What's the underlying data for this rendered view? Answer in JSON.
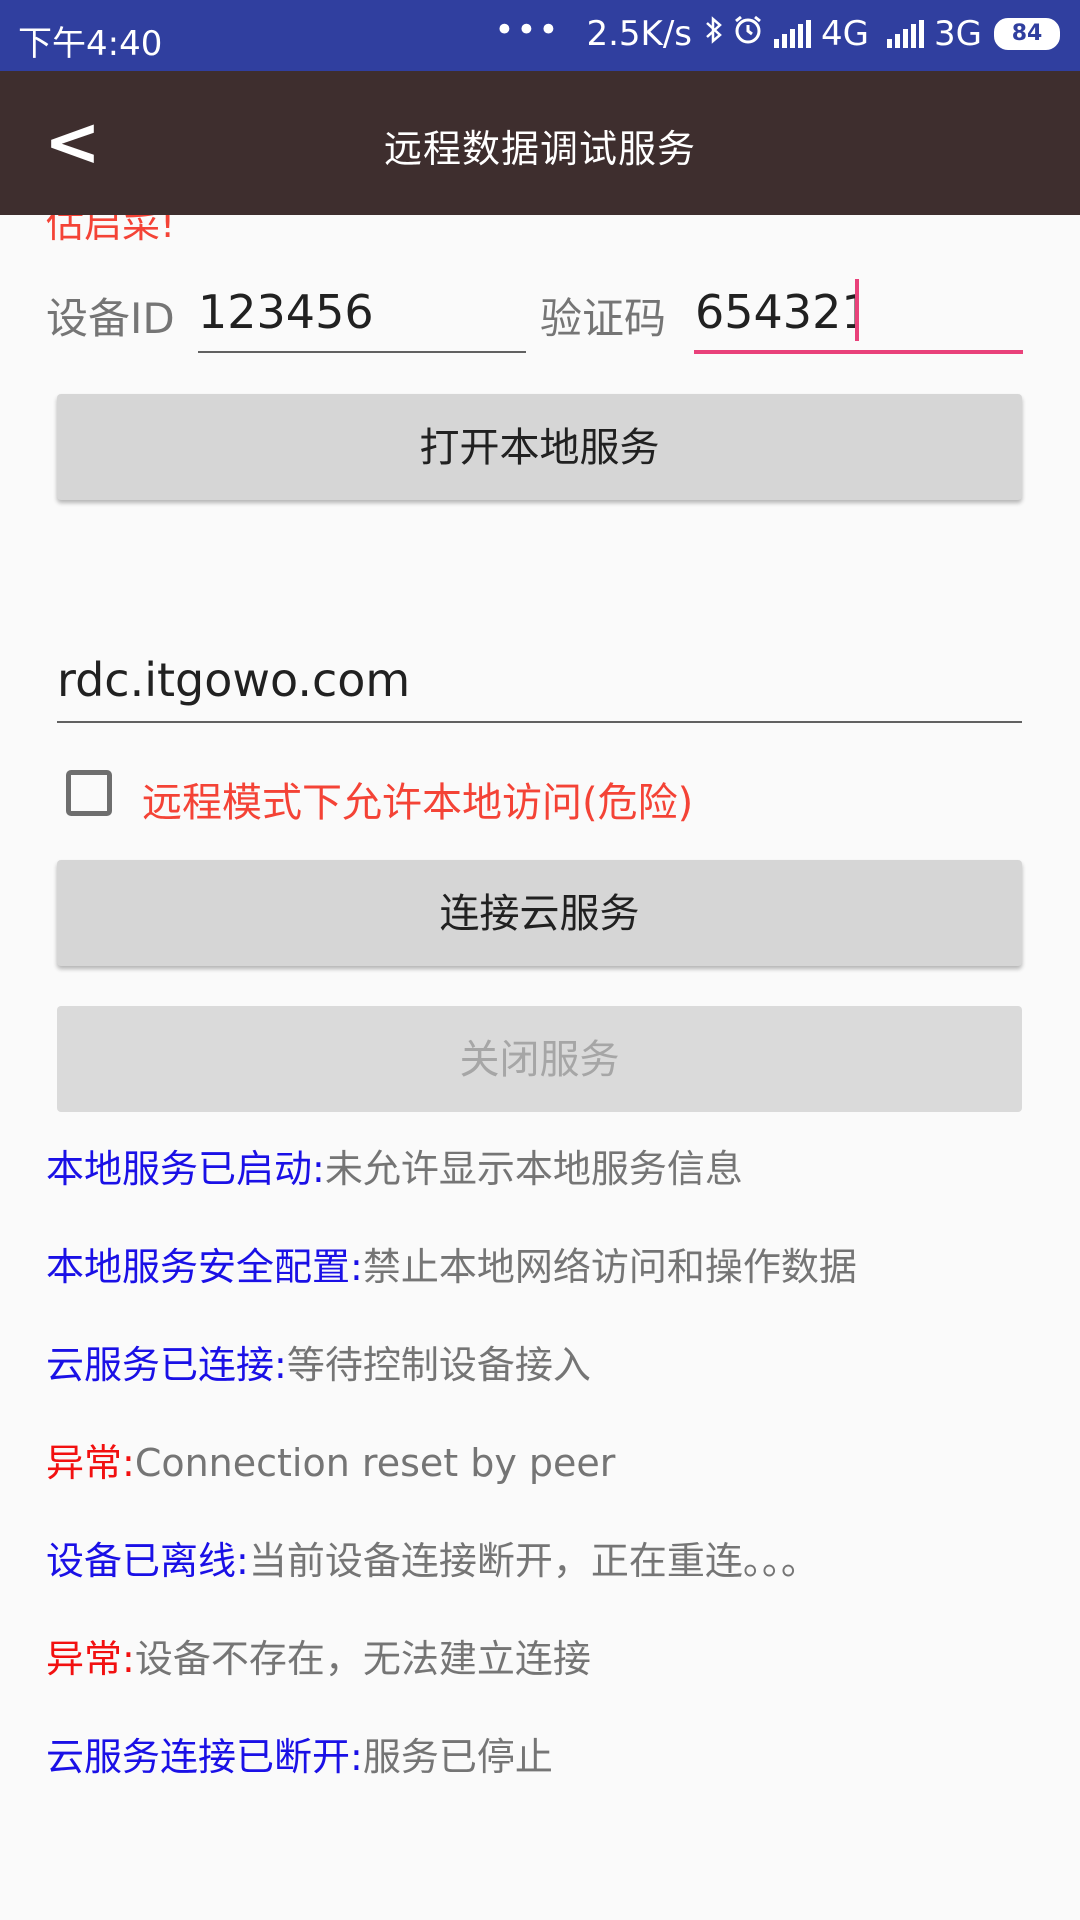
{
  "status_bar": {
    "time": "下午4:40",
    "dots": "•••",
    "net_speed": "2.5K/s",
    "bluetooth_icon": "bluetooth-icon",
    "alarm_icon": "alarm-icon",
    "net1": "4G",
    "net2": "3G",
    "battery": "84"
  },
  "toolbar": {
    "back_icon": "<",
    "title": "远程数据调试服务"
  },
  "content": {
    "cut_text": "估启菜!",
    "device_id_label": "设备ID",
    "device_id_value": "123456",
    "verify_code_label": "验证码",
    "verify_code_value": "654321",
    "open_local_service": "打开本地服务",
    "server_value": "rdc.itgowo.com",
    "allow_local_label": "远程模式下允许本地访问(危险)",
    "connect_cloud": "连接云服务",
    "close_service": "关闭服务"
  },
  "logs": [
    {
      "key": "本地服务已启动:",
      "value": "未允许显示本地服务信息",
      "color": "blue"
    },
    {
      "key": "本地服务安全配置:",
      "value": "禁止本地网络访问和操作数据",
      "color": "blue"
    },
    {
      "key": "云服务已连接:",
      "value": "等待控制设备接入",
      "color": "blue"
    },
    {
      "key": "异常:",
      "value": "Connection reset by peer",
      "color": "red"
    },
    {
      "key": "设备已离线:",
      "value": "当前设备连接断开，正在重连。。。",
      "color": "blue"
    },
    {
      "key": "异常:",
      "value": "设备不存在，无法建立连接",
      "color": "red"
    },
    {
      "key": "云服务连接已断开:",
      "value": "服务已停止",
      "color": "blue"
    }
  ],
  "colors": {
    "status_bar": "#303f9f",
    "toolbar": "#3e2e2e",
    "accent": "#e9417a",
    "warning": "#f44336",
    "log_blue": "#1a10e6",
    "log_red": "#f21010"
  }
}
